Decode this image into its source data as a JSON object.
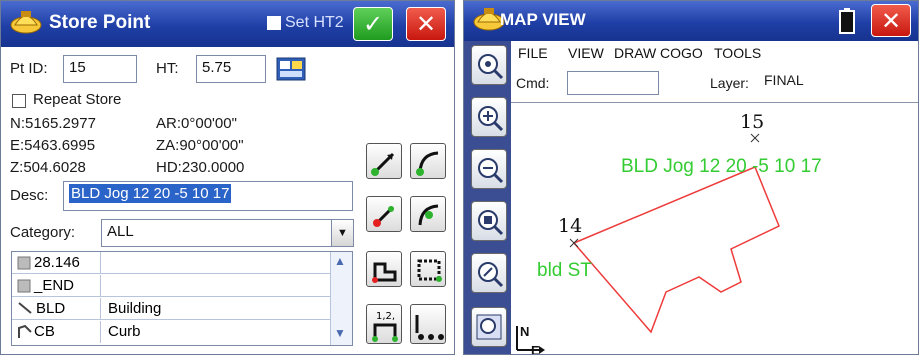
{
  "store_point": {
    "title": "Store Point",
    "set_ht2_label": "Set HT2",
    "ok_symbol": "✓",
    "close_symbol": "✕",
    "pt_id_label": "Pt ID:",
    "pt_id_value": "15",
    "ht_label": "HT:",
    "ht_value": "5.75",
    "repeat_store_label": "Repeat Store",
    "north": "N:5165.2977",
    "east": "E:5463.6995",
    "elev": "Z:504.6028",
    "ar": "AR:0°00'00\"",
    "za": "ZA:90°00'00\"",
    "hd": "HD:230.0000",
    "desc_label": "Desc:",
    "desc_value": "BLD Jog 12 20 -5 10 17",
    "category_label": "Category:",
    "category_value": "ALL",
    "category_rows": [
      {
        "code": "28.146",
        "description": ""
      },
      {
        "code": "_END",
        "description": ""
      },
      {
        "code": "BLD",
        "description": "Building"
      },
      {
        "code": "CB",
        "description": "Curb"
      }
    ]
  },
  "map_view": {
    "title": "MAP VIEW",
    "close_symbol": "✕",
    "menu": [
      "FILE",
      "VIEW",
      "DRAW",
      "COGO",
      "TOOLS"
    ],
    "cmd_label": "Cmd:",
    "cmd_value": "",
    "layer_label": "Layer:",
    "layer_value": "FINAL",
    "point_15_label": "15",
    "point_14_label": "14",
    "point_15_desc": "BLD Jog 12 20 -5 10 17",
    "point_14_desc": "bld ST",
    "north_label": "N",
    "east_label": "E"
  },
  "colors": {
    "titlebar": "#1f3fa6",
    "selection": "#2b64c8",
    "map_text_green": "#33cc33",
    "polyline_red": "#ee3b3b"
  }
}
